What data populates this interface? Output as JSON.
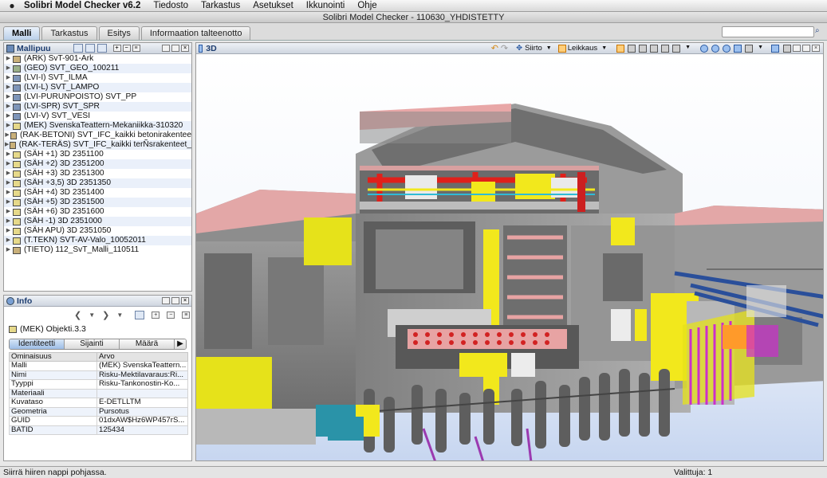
{
  "menubar": {
    "apple_icon": "apple-icon",
    "app_name": "Solibri Model Checker v6.2",
    "items": [
      "Tiedosto",
      "Tarkastus",
      "Asetukset",
      "Ikkunointi",
      "Ohje"
    ]
  },
  "window": {
    "title": "Solibri Model Checker - 110630_YHDISTETTY"
  },
  "tabs": [
    {
      "label": "Malli",
      "active": true
    },
    {
      "label": "Tarkastus",
      "active": false
    },
    {
      "label": "Esitys",
      "active": false
    },
    {
      "label": "Informaation talteenotto",
      "active": false
    }
  ],
  "search": {
    "placeholder": "",
    "icon": "binoculars-icon"
  },
  "model_tree": {
    "title": "Mallipuu",
    "items": [
      {
        "label": "(ARK) SvT-901-Ark",
        "icon": "building-icon"
      },
      {
        "label": "(GEO) SVT_GEO_100211",
        "icon": "geo-icon"
      },
      {
        "label": "(LVI-I) SVT_ILMA",
        "icon": "hvac-icon"
      },
      {
        "label": "(LVI-L) SVT_LAMPO",
        "icon": "hvac-icon"
      },
      {
        "label": "(LVI-PURUNPOISTO) SVT_PP",
        "icon": "hvac-icon"
      },
      {
        "label": "(LVI-SPR) SVT_SPR",
        "icon": "hvac-icon"
      },
      {
        "label": "(LVI-V) SVT_VESI",
        "icon": "hvac-icon"
      },
      {
        "label": "(MEK) SvenskaTeattern-Mekaniikka-310320",
        "icon": "electrical-icon"
      },
      {
        "label": "(RAK-BETONI) SVT_IFC_kaikki betonirakentee",
        "icon": "building-icon"
      },
      {
        "label": "(RAK-TERÄS) SVT_IFC_kaikki terÑsrakenteet_",
        "icon": "building-icon"
      },
      {
        "label": "(SÄH +1) 3D 2351100",
        "icon": "electrical-icon"
      },
      {
        "label": "(SÄH +2) 3D 2351200",
        "icon": "electrical-icon"
      },
      {
        "label": "(SÄH +3) 3D 2351300",
        "icon": "electrical-icon"
      },
      {
        "label": "(SÄH +3,5) 3D 2351350",
        "icon": "electrical-icon"
      },
      {
        "label": "(SÄH +4) 3D 2351400",
        "icon": "electrical-icon"
      },
      {
        "label": "(SÄH +5) 3D 2351500",
        "icon": "electrical-icon"
      },
      {
        "label": "(SÄH +6) 3D 2351600",
        "icon": "electrical-icon"
      },
      {
        "label": "(SÄH -1) 3D 2351000",
        "icon": "electrical-icon"
      },
      {
        "label": "(SÄH APU) 3D 2351050",
        "icon": "electrical-icon"
      },
      {
        "label": "(T.TEKN) SVT-AV-Valo_10052011",
        "icon": "electrical-icon"
      },
      {
        "label": "(TIETO) 112_SvT_Malli_110511",
        "icon": "building-icon"
      }
    ]
  },
  "info": {
    "title": "Info",
    "object_label": "(MEK) Objekti.3.3",
    "subtabs": [
      "Identiteetti",
      "Sijainti",
      "Määrä"
    ],
    "columns": [
      "Ominaisuus",
      "Arvo"
    ],
    "rows": [
      [
        "Malli",
        "(MEK) SvenskaTeattern..."
      ],
      [
        "Nimi",
        "Risku-Mektilavaraus:Ri..."
      ],
      [
        "Tyyppi",
        "Risku-Tankonostin-Ko..."
      ],
      [
        "Materiaali",
        ""
      ],
      [
        "Kuvataso",
        "E-DETLLTM"
      ],
      [
        "Geometria",
        "Pursotus"
      ],
      [
        "GUID",
        "01dxAW$Hz6WP457rS..."
      ],
      [
        "BATID",
        "125434"
      ]
    ]
  },
  "view3d": {
    "title": "3D",
    "move_label": "Siirto",
    "section_label": "Leikkaus"
  },
  "status": {
    "left": "Siirrä hiiren nappi pohjassa.",
    "right": "Valittuja: 1"
  }
}
